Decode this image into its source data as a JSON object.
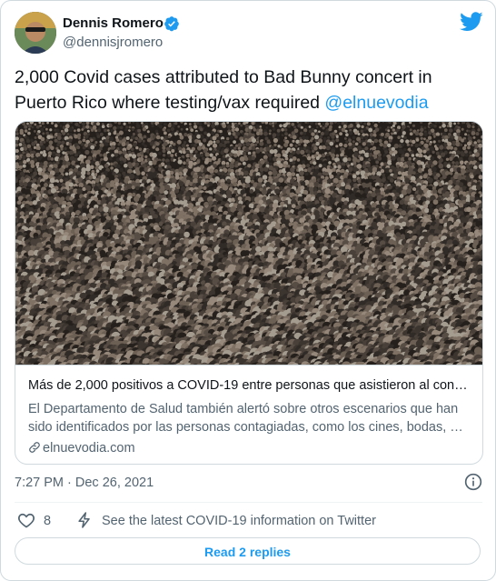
{
  "author": {
    "name": "Dennis Romero",
    "handle": "@dennisjromero",
    "verified": true
  },
  "icons": {
    "avatar": "profile-photo",
    "verified": "verified-badge-icon",
    "logo": "twitter-bird-icon",
    "link": "link-chain-icon",
    "info": "info-icon",
    "like": "heart-icon",
    "covid": "lightning-bolt-icon"
  },
  "tweet": {
    "text": "2,000 Covid cases attributed to Bad Bunny concert in Puerto Rico where testing/vax required ",
    "mention": "@elnuevodia"
  },
  "link_card": {
    "image_alt": "crowd-at-concert-photo",
    "title": "Más de 2,000 positivos a COVID-19 entre personas que asistieron al con…",
    "description": "El Departamento de Salud también alertó sobre otros escenarios que han sido identificados por las personas contagiadas, como los cines, bodas, …",
    "domain": "elnuevodia.com"
  },
  "timestamp": "7:27 PM · Dec 26, 2021",
  "actions": {
    "like_count": "8",
    "covid_info": "See the latest COVID-19 information on Twitter",
    "read_replies": "Read 2 replies"
  },
  "colors": {
    "accent": "#1d9bf0",
    "text": "#0f1419",
    "secondary": "#536471",
    "border": "#cfd9de"
  }
}
